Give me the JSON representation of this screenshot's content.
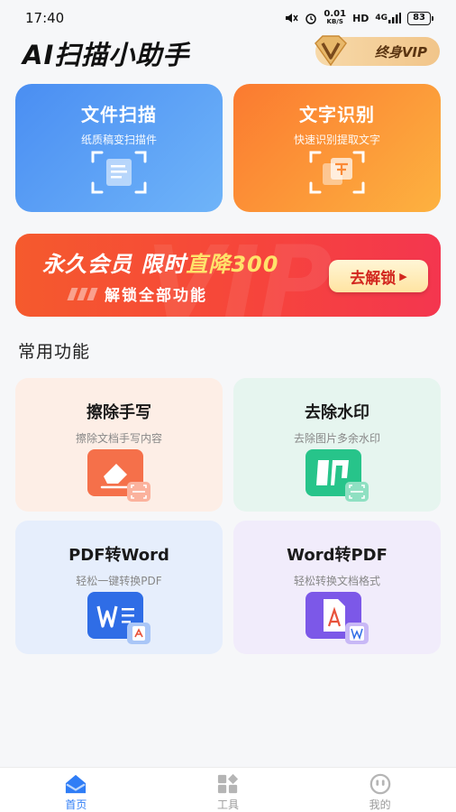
{
  "status": {
    "time": "17:40",
    "speed": "0.01",
    "speed_unit": "KB/S",
    "hd": "HD",
    "network": "4G",
    "battery": "83"
  },
  "header": {
    "title": "AI扫描小助手",
    "vip_label": "终身VIP"
  },
  "cards": [
    {
      "title": "文件扫描",
      "subtitle": "纸质稿变扫描件"
    },
    {
      "title": "文字识别",
      "subtitle": "快速识别提取文字"
    }
  ],
  "banner": {
    "line1_a": "永久会员 限时",
    "line1_b": "直降300",
    "subtitle": "解锁全部功能",
    "button": "去解锁",
    "deco": "VIP"
  },
  "section": {
    "title": "常用功能"
  },
  "features": [
    {
      "title": "擦除手写",
      "subtitle": "擦除文档手写内容"
    },
    {
      "title": "去除水印",
      "subtitle": "去除图片多余水印"
    },
    {
      "title": "PDF转Word",
      "subtitle": "轻松一键转换PDF"
    },
    {
      "title": "Word转PDF",
      "subtitle": "轻松转换文档格式"
    }
  ],
  "tabs": [
    {
      "label": "首页",
      "icon": "home-icon",
      "active": true
    },
    {
      "label": "工具",
      "icon": "tools-icon",
      "active": false
    },
    {
      "label": "我的",
      "icon": "profile-icon",
      "active": false
    }
  ],
  "colors": {
    "accent": "#2f7df6",
    "scan": "#4a8ef2",
    "ocr": "#fb7a30",
    "banner": "#f6453b"
  }
}
